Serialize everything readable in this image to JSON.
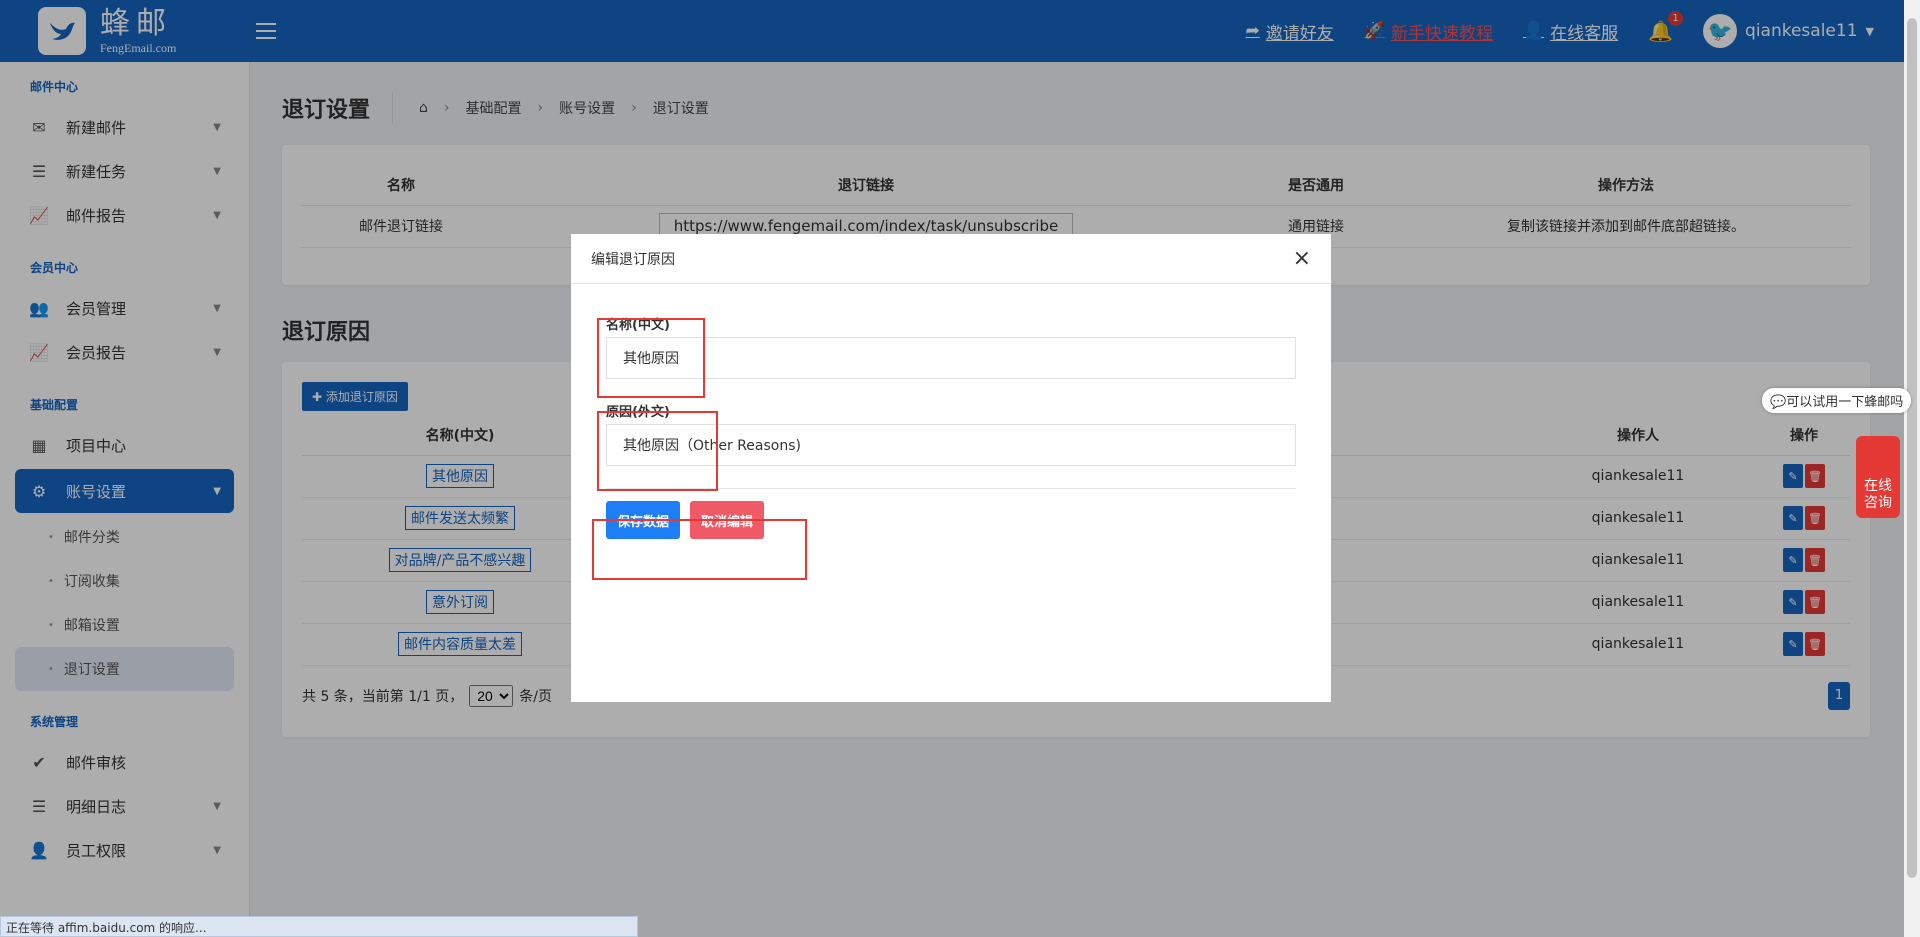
{
  "brand": {
    "name_cn": "蜂邮",
    "name_en": "FengEmail.com"
  },
  "topbar": {
    "invite": "邀请好友",
    "tutorial": "新手快速教程",
    "service": "在线客服",
    "notify_count": "1",
    "username": "qiankesale11"
  },
  "sidebar": {
    "groups": [
      {
        "title": "邮件中心",
        "items": [
          "新建邮件",
          "新建任务",
          "邮件报告"
        ]
      },
      {
        "title": "会员中心",
        "items": [
          "会员管理",
          "会员报告"
        ]
      },
      {
        "title": "基础配置",
        "items": [
          "项目中心",
          "账号设置"
        ]
      },
      {
        "title": "系统管理",
        "items": [
          "邮件审核",
          "明细日志",
          "员工权限"
        ]
      }
    ],
    "sub_items": [
      "邮件分类",
      "订阅收集",
      "邮箱设置",
      "退订设置"
    ]
  },
  "page": {
    "title": "退订设置",
    "breadcrumbs": [
      "基础配置",
      "账号设置",
      "退订设置"
    ]
  },
  "link_table": {
    "headers": [
      "名称",
      "退订链接",
      "是否通用",
      "操作方法"
    ],
    "row": [
      "邮件退订链接",
      "https://www.fengemail.com/index/task/unsubscribe",
      "通用链接",
      "复制该链接并添加到邮件底部超链接。"
    ]
  },
  "reasons": {
    "section_title": "退订原因",
    "add_button": "添加退订原因",
    "headers": {
      "name": "名称(中文)",
      "operator": "操作人",
      "action": "操作"
    },
    "rows": [
      {
        "name": "其他原因",
        "operator": "qiankesale11"
      },
      {
        "name": "邮件发送太频繁",
        "operator": "qiankesale11"
      },
      {
        "name": "对品牌/产品不感兴趣",
        "operator": "qiankesale11"
      },
      {
        "name": "意外订阅",
        "operator": "qiankesale11"
      },
      {
        "name": "邮件内容质量太差",
        "operator": "qiankesale11"
      }
    ],
    "pager": {
      "summary": "共 5 条，当前第 1/1 页，",
      "page_size": "20",
      "unit": "条/页",
      "current_page": "1"
    }
  },
  "modal": {
    "title": "编辑退订原因",
    "close": "×",
    "field1_label": "名称(中文)",
    "field1_value": "其他原因",
    "field2_label": "原因(外文)",
    "field2_value": "其他原因（Other Reasons)",
    "save": "保存数据",
    "cancel": "取消编辑"
  },
  "widget": {
    "bubble": "可以试用一下蜂邮吗",
    "consult": "在线咨询"
  },
  "status_bar": "正在等待 affim.baidu.com 的响应...",
  "colors": {
    "primary": "#1565c0",
    "danger": "#e53935",
    "save": "#1e7ef5",
    "cancel": "#f05a66"
  }
}
